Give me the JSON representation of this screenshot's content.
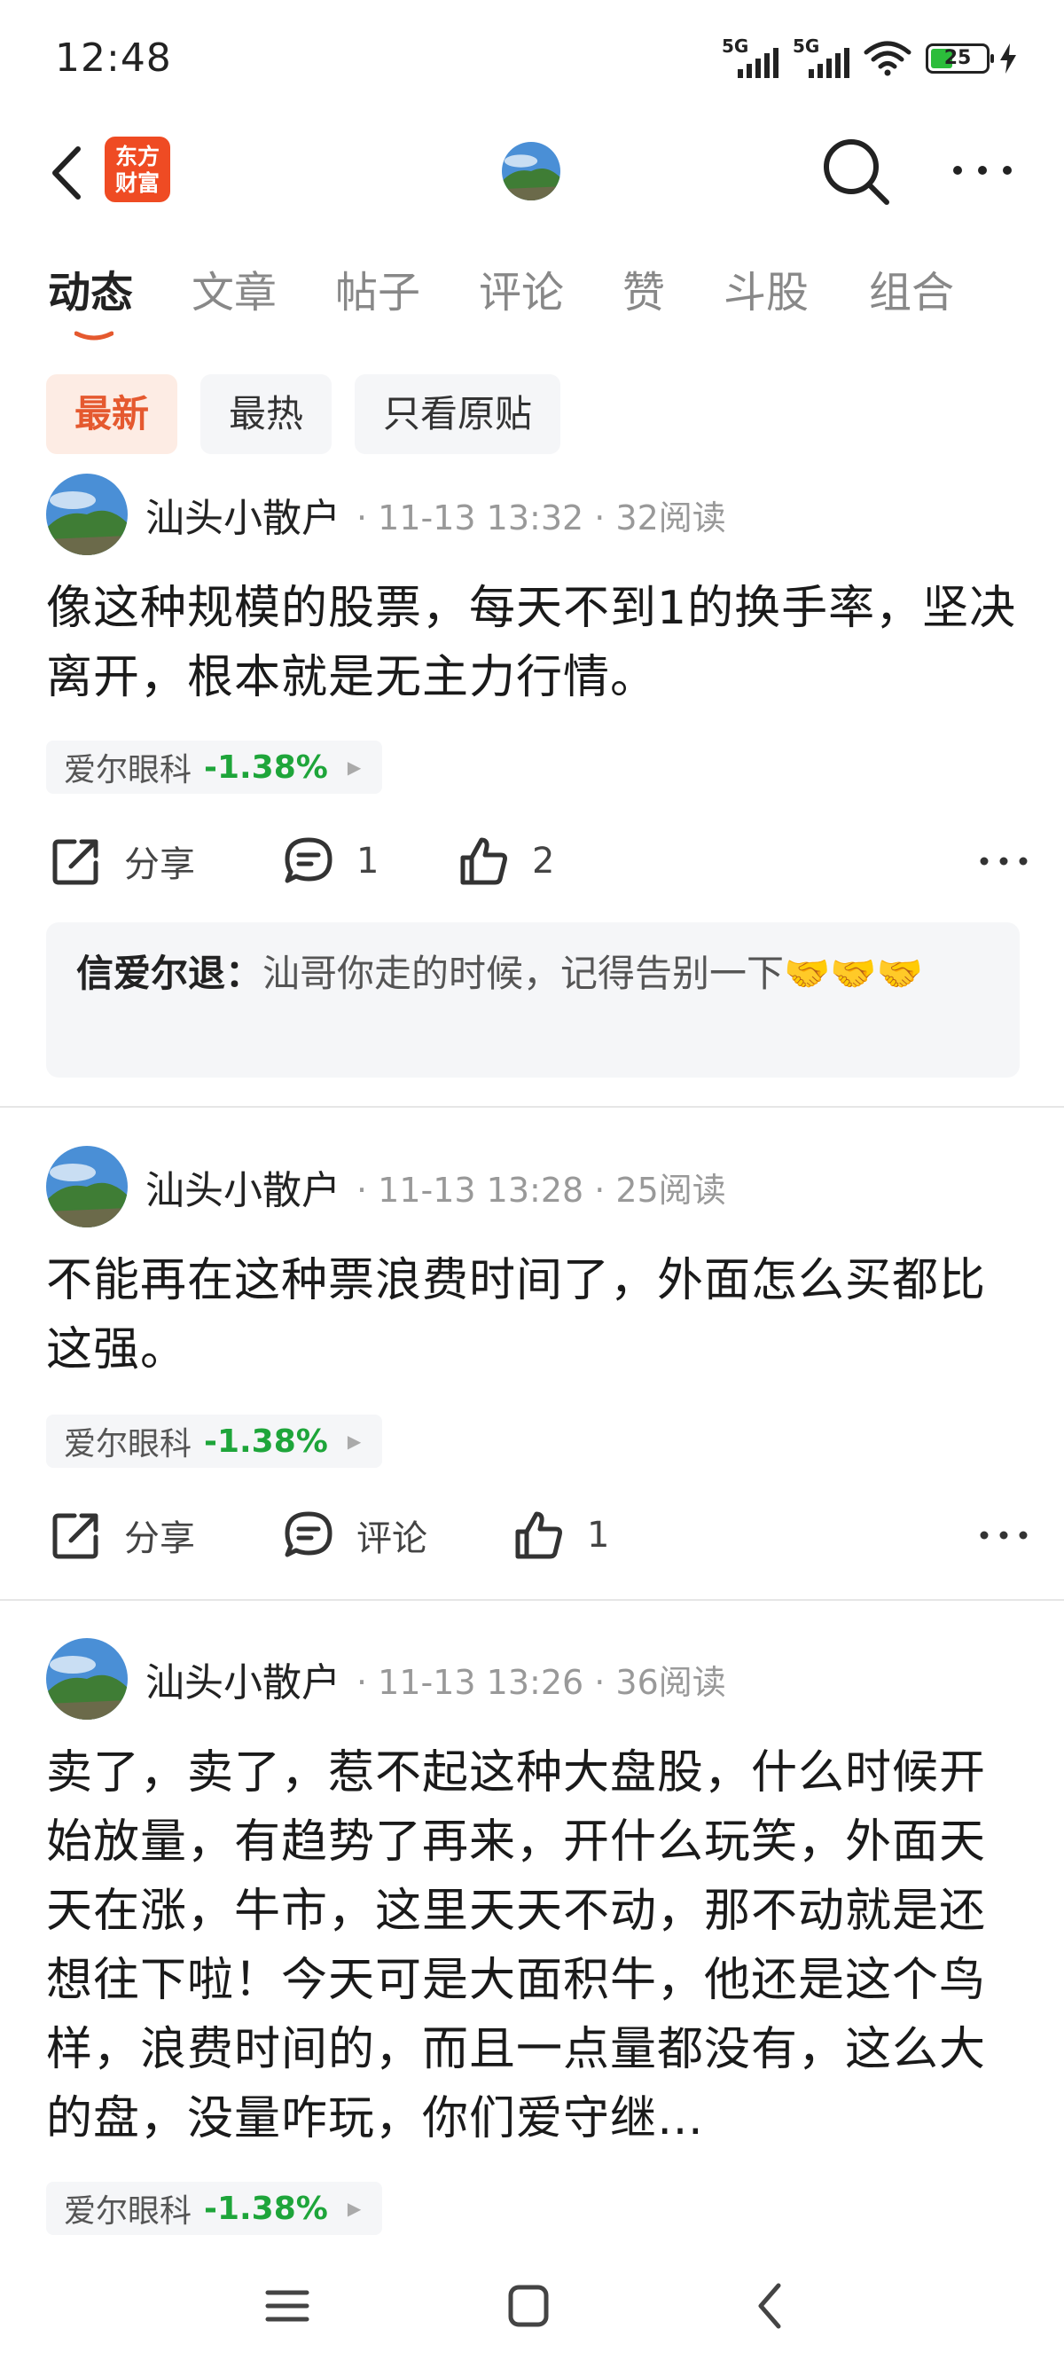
{
  "status_bar": {
    "time": "12:48",
    "signal1_label": "5G",
    "signal2_label": "5G",
    "battery": "25"
  },
  "nav": {
    "logo_line1": "东方",
    "logo_line2": "财富"
  },
  "tabs": [
    {
      "label": "动态",
      "active": true
    },
    {
      "label": "文章"
    },
    {
      "label": "帖子"
    },
    {
      "label": "评论"
    },
    {
      "label": "赞"
    },
    {
      "label": "斗股"
    },
    {
      "label": "组合"
    }
  ],
  "filters": [
    {
      "label": "最新",
      "active": true
    },
    {
      "label": "最热"
    },
    {
      "label": "只看原贴"
    }
  ],
  "colors": {
    "accent": "#e5592f",
    "stock_down": "#1ea53a",
    "logo": "#ef4b23"
  },
  "posts": [
    {
      "author": "汕头小散户",
      "meta": "· 11-13 13:32 · 32阅读",
      "text": "像这种规模的股票，每天不到1的换手率，坚决离开，根本就是无主力行情。",
      "stock_name": "爱尔眼科",
      "stock_change": "-1.38%",
      "share_label": "分享",
      "comment_label": "1",
      "like_label": "2",
      "reply": {
        "author": "信爱尔退：",
        "text": "汕哥你走的时候，记得告别一下🤝🤝🤝"
      }
    },
    {
      "author": "汕头小散户",
      "meta": "· 11-13 13:28 · 25阅读",
      "text": "不能再在这种票浪费时间了，外面怎么买都比这强。",
      "stock_name": "爱尔眼科",
      "stock_change": "-1.38%",
      "share_label": "分享",
      "comment_label": "评论",
      "like_label": "1"
    },
    {
      "author": "汕头小散户",
      "meta": "· 11-13 13:26 · 36阅读",
      "text": "卖了，卖了，惹不起这种大盘股，什么时候开始放量，有趋势了再来，开什么玩笑，外面天天在涨，牛市，这里天天不动，那不动就是还想往下啦！今天可是大面积牛，他还是这个鸟样，浪费时间的，而且一点量都没有，这么大的盘，没量咋玩，你们爱守继…",
      "stock_name": "爱尔眼科",
      "stock_change": "-1.38%"
    }
  ]
}
